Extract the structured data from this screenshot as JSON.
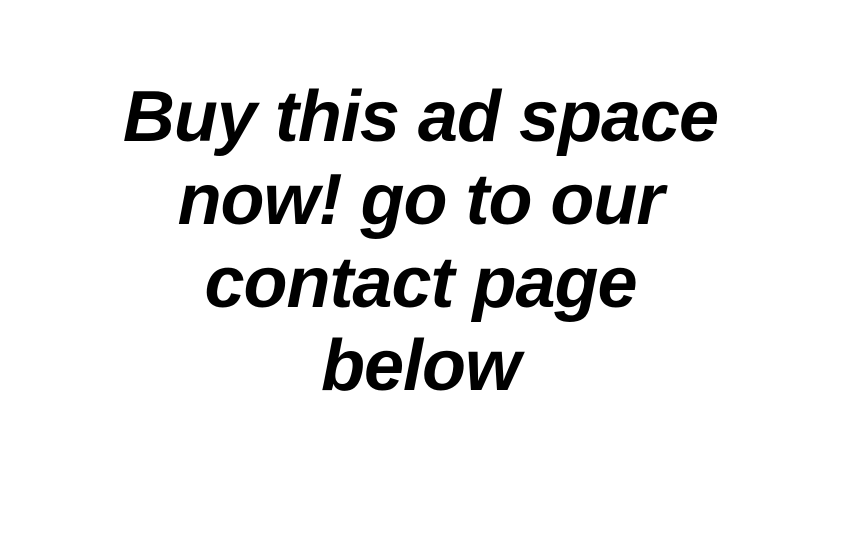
{
  "ad": {
    "lines": [
      "Buy this ad space",
      "now! go to our",
      "contact page",
      "below"
    ]
  },
  "colors": {
    "background": "#ffffff",
    "text": "#000000"
  }
}
